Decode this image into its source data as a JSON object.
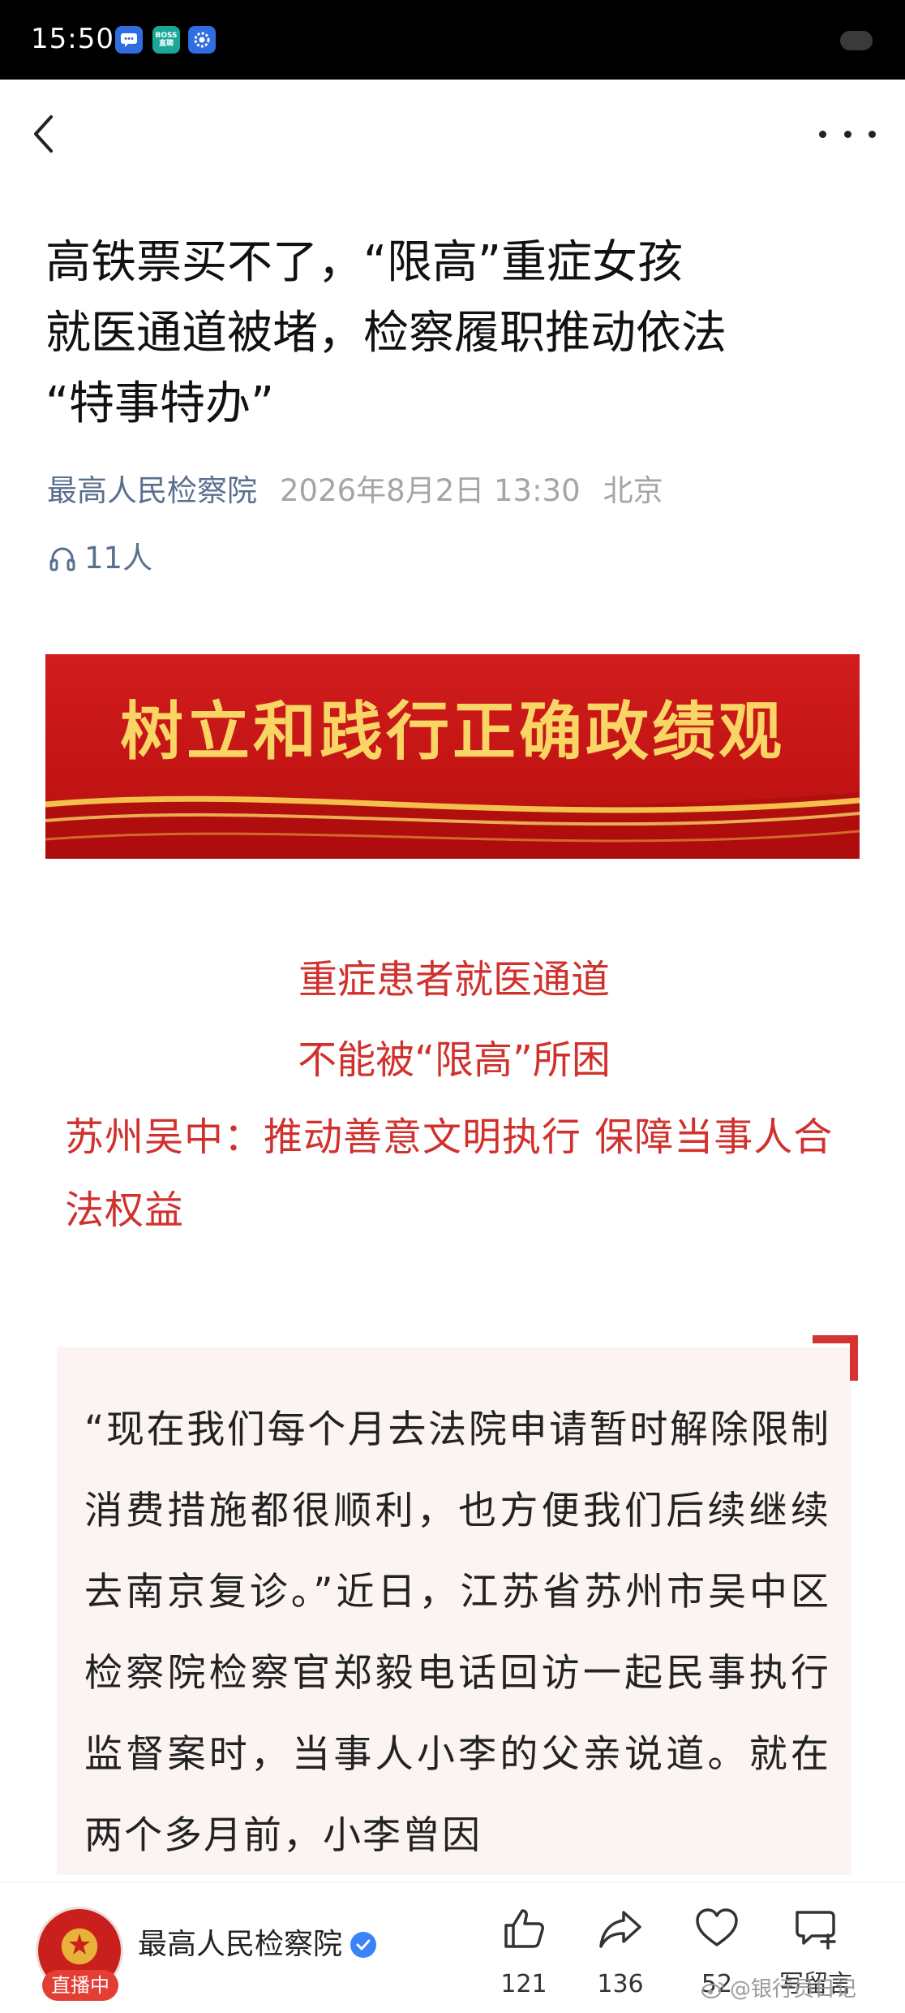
{
  "status_bar": {
    "time": "15:50",
    "icons": [
      "message-icon",
      "boss-zhipin-icon",
      "settings-icon"
    ],
    "boss_icon_line1": "BOSS",
    "boss_icon_line2": "直聘"
  },
  "nav": {
    "back_icon": "chevron-left-icon",
    "more_icon": "more-horizontal-icon"
  },
  "article": {
    "title_line1": "高铁票买不了，“限高”重症女孩",
    "title_line2": "就医通道被堵，检察履职推动依法",
    "title_line3": "“特事特办”",
    "source": "最高人民检察院",
    "date": "2026年8月2日 13:30",
    "location": "北京",
    "listeners": "11人",
    "banner_text": "树立和践行正确政绩观",
    "headline_1": "重症患者就医通道",
    "headline_2": "不能被“限高”所困",
    "headline_3": "苏州吴中：推动善意文明执行 保障当事人合法权益",
    "quote_paragraph": "“现在我们每个月去法院申请暂时解除限制消费措施都很顺利，也方便我们后续继续去南京复诊。”近日，江苏省苏州市吴中区检察院检察官郑毅电话回访一起民事执行监督案时，当事人小李的父亲说道。就在两个多月前，小李曾因"
  },
  "bottom_bar": {
    "source": "最高人民检察院",
    "live_badge": "直播中",
    "likes": "121",
    "shares": "136",
    "favorites": "52",
    "comment_label": "写留言"
  },
  "watermark": "@银行员日记",
  "colors": {
    "headline_red": "#d0312d",
    "banner_red": "#c41414",
    "banner_gold": "#f9d566",
    "source_blue_gray": "#5a6f8f",
    "quote_bg": "#fbf4f2"
  }
}
